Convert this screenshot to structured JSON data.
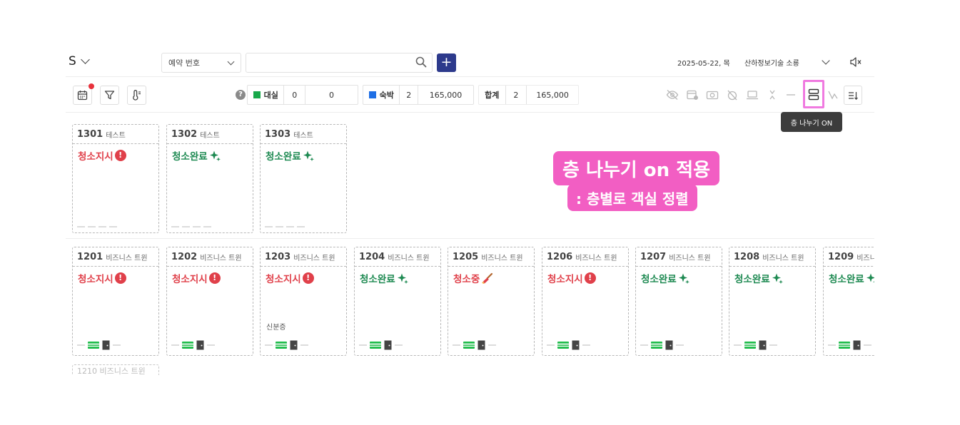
{
  "header": {
    "brand": "S",
    "search_type": "예약 번호",
    "search_value": "",
    "search_placeholder": "",
    "add_label": "+",
    "date": "2025-05-22, 목",
    "company": "산하정보기술 소룡"
  },
  "stats": {
    "help_label": "?",
    "rental": {
      "label": "대실",
      "count": "0",
      "amount": "0",
      "color": "#18a84a"
    },
    "stay": {
      "label": "숙박",
      "count": "2",
      "amount": "165,000",
      "color": "#1f6fe5"
    },
    "total": {
      "label": "합계",
      "count": "2",
      "amount": "165,000"
    }
  },
  "tooltip": "층 나누기 ON",
  "callout": {
    "line1": "층 나누기 on 적용",
    "line2": ": 층별로 객실 정렬"
  },
  "status_colors": {
    "red": "#e0404a",
    "green": "#1e8a52"
  },
  "floors": [
    {
      "rooms": [
        {
          "number": "1301",
          "type": "테스트",
          "status": "청소지시",
          "status_icon": "alert-icon",
          "note": "",
          "foot": "dashes"
        },
        {
          "number": "1302",
          "type": "테스트",
          "status": "청소완료",
          "status_icon": "sparkle-icon",
          "note": "",
          "foot": "dashes"
        },
        {
          "number": "1303",
          "type": "테스트",
          "status": "청소완료",
          "status_icon": "sparkle-icon",
          "note": "",
          "foot": "dashes"
        }
      ]
    },
    {
      "rooms": [
        {
          "number": "1201",
          "type": "비즈니스 트윈",
          "status": "청소지시",
          "status_icon": "alert-icon",
          "note": "",
          "foot": "card-key"
        },
        {
          "number": "1202",
          "type": "비즈니스 트윈",
          "status": "청소지시",
          "status_icon": "alert-icon",
          "note": "",
          "foot": "card-key"
        },
        {
          "number": "1203",
          "type": "비즈니스 트윈",
          "status": "청소지시",
          "status_icon": "alert-icon",
          "note": "신분증",
          "foot": "card-key"
        },
        {
          "number": "1204",
          "type": "비즈니스 트윈",
          "status": "청소완료",
          "status_icon": "sparkle-icon",
          "note": "",
          "foot": "card-key"
        },
        {
          "number": "1205",
          "type": "비즈니스 트윈",
          "status": "청소중",
          "status_icon": "broom-icon",
          "note": "",
          "foot": "card-key"
        },
        {
          "number": "1206",
          "type": "비즈니스 트윈",
          "status": "청소지시",
          "status_icon": "alert-icon",
          "note": "",
          "foot": "card-key"
        },
        {
          "number": "1207",
          "type": "비즈니스 트윈",
          "status": "청소완료",
          "status_icon": "sparkle-icon",
          "note": "",
          "foot": "card-key"
        },
        {
          "number": "1208",
          "type": "비즈니스 트윈",
          "status": "청소완료",
          "status_icon": "sparkle-icon",
          "note": "",
          "foot": "card-key"
        },
        {
          "number": "1209",
          "type": "비즈니스 트윈",
          "status": "청소완료",
          "status_icon": "sparkle-icon",
          "note": "",
          "foot": "card-key"
        }
      ]
    }
  ],
  "partial_card": "1210 비즈니스 트윈"
}
